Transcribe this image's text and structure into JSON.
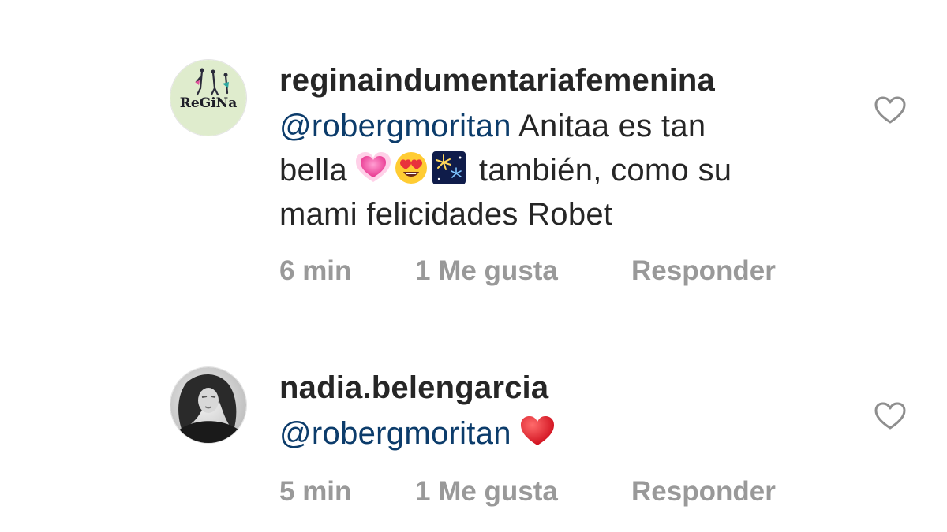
{
  "comments": [
    {
      "username": "reginaindumentariafemenina",
      "avatar_text": "ReGiNa",
      "mention": "@robergmoritan",
      "text_line1": " Anitaa es tan",
      "text_line2_start": "bella ",
      "text_line2_end": " también, como su",
      "text_line3": "mami felicidades Robet",
      "emojis": [
        "growing-heart-emoji",
        "heart-eyes-emoji",
        "fireworks-emoji"
      ],
      "time": "6 min",
      "likes": "1 Me gusta",
      "reply": "Responder"
    },
    {
      "username": "nadia.belengarcia",
      "mention": "@robergmoritan",
      "emojis": [
        "red-heart-emoji"
      ],
      "time": "5 min",
      "likes": "1 Me gusta",
      "reply": "Responder"
    }
  ],
  "colors": {
    "text": "#262626",
    "mention": "#0c3c6b",
    "meta": "#999999",
    "like_icon": "#8e8e8e"
  }
}
